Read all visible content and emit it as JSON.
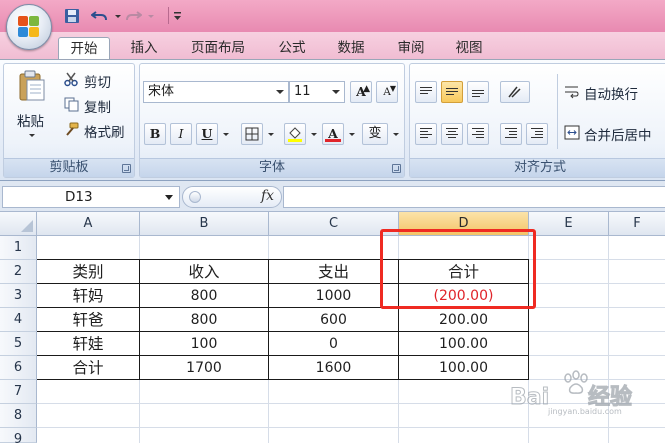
{
  "quick_access": {
    "save_icon": "save-icon",
    "undo_icon": "undo-icon",
    "redo_icon": "redo-icon",
    "customize_icon": "customize-arrow-icon"
  },
  "tabs": [
    {
      "label": "开始",
      "active": true
    },
    {
      "label": "插入"
    },
    {
      "label": "页面布局"
    },
    {
      "label": "公式"
    },
    {
      "label": "数据"
    },
    {
      "label": "审阅"
    },
    {
      "label": "视图"
    }
  ],
  "clipboard": {
    "paste_label": "粘贴",
    "cut_label": "剪切",
    "copy_label": "复制",
    "format_painter_label": "格式刷",
    "group_label": "剪贴板"
  },
  "font": {
    "font_name": "宋体",
    "font_size": "11",
    "grow_label": "A",
    "shrink_label": "A",
    "bold_label": "B",
    "italic_label": "I",
    "underline_label": "U",
    "font_color_label": "A",
    "phonetic_label": "变",
    "group_label": "字体"
  },
  "alignment": {
    "wrap_label": "自动换行",
    "merge_label": "合并后居中",
    "group_label": "对齐方式"
  },
  "formula_bar": {
    "name_box": "D13",
    "fx_label": "fx",
    "formula": ""
  },
  "columns": [
    "A",
    "B",
    "C",
    "D",
    "E",
    "F"
  ],
  "selected_column": "D",
  "rows": [
    "1",
    "2",
    "3",
    "4",
    "5",
    "6",
    "7",
    "8",
    "9"
  ],
  "table": {
    "headers": [
      "类别",
      "收入",
      "支出",
      "合计"
    ],
    "rows": [
      [
        "轩妈",
        "800",
        "1000",
        "(200.00)"
      ],
      [
        "轩爸",
        "800",
        "600",
        "200.00"
      ],
      [
        "轩娃",
        "100",
        "0",
        "100.00"
      ],
      [
        "合计",
        "1700",
        "1600",
        "100.00"
      ]
    ]
  },
  "colors": {
    "highlight_box": "#ef2a22",
    "negative_value": "#e0242a",
    "title_bar": "#ea92b7"
  },
  "watermark": {
    "brand": "Baidu 经验",
    "url": "jingyan.baidu.com"
  }
}
